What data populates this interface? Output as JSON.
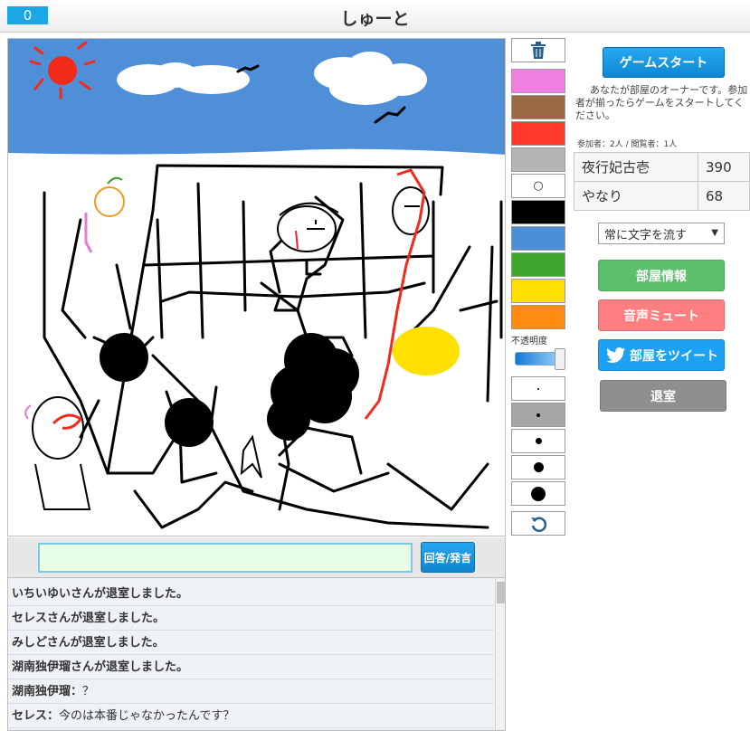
{
  "header": {
    "score": "0",
    "title": "しゅーと"
  },
  "tools": {
    "trash_icon": "trash-icon",
    "colors": [
      "#ef7fe0",
      "#9b6a45",
      "#ff3a2a",
      "#b5b5b5",
      "#ffffff",
      "#000000",
      "#4a90d9",
      "#3fa62e",
      "#ffe000",
      "#ff8c10"
    ],
    "white_mark": "○",
    "opacity_label": "不透明度",
    "opacity_value": 0.95,
    "pen_sizes": [
      "1",
      "2",
      "3",
      "4",
      "5"
    ],
    "selected_pen": 1,
    "undo_icon": "undo-icon"
  },
  "sidebar": {
    "start_button": "ゲームスタート",
    "owner_message": "あなたが部屋のオーナーです。参加者が揃ったらゲームをスタートしてください。",
    "counts": "参加者：2人 / 閲覧者：1人",
    "players": [
      {
        "name": "夜行妃古壱",
        "score": "390"
      },
      {
        "name": "やなり",
        "score": "68"
      }
    ],
    "message_mode": "常に文字を流す",
    "room_info_button": "部屋情報",
    "mute_button": "音声ミュート",
    "tweet_button": "部屋をツイート",
    "leave_button": "退室"
  },
  "answer": {
    "placeholder": "",
    "button": "回答/発言"
  },
  "chat": [
    {
      "name": "",
      "text": "いちいゆいさんが退室しました。"
    },
    {
      "name": "",
      "text": "セレスさんが退室しました。"
    },
    {
      "name": "",
      "text": "みしどさんが退室しました。"
    },
    {
      "name": "",
      "text": "湖南独伊瑠さんが退室しました。"
    },
    {
      "name": "湖南独伊瑠：",
      "text": "？"
    },
    {
      "name": "セレス：",
      "text": "今のは本番じゃなかったんです？"
    }
  ]
}
